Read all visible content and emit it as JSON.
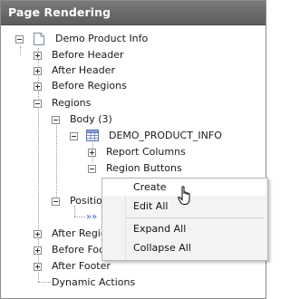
{
  "panel": {
    "title": "Page Rendering"
  },
  "tree": {
    "root": "Demo Product Info",
    "before_header": "Before Header",
    "after_header": "After Header",
    "before_regions": "Before Regions",
    "regions": "Regions",
    "body": "Body (3)",
    "region_name": "DEMO_PRODUCT_INFO",
    "report_columns": "Report Columns",
    "region_buttons": "Region Buttons",
    "position_partial": "Positio",
    "position_child_partial": "»»",
    "after_regions_partial": "After Regio",
    "before_footer_partial": "Before Foo",
    "after_footer": "After Footer",
    "dynamic_actions": "Dynamic Actions"
  },
  "context_menu": {
    "items": [
      "Create",
      "Edit All",
      "Expand All",
      "Collapse All"
    ],
    "hovered": "Create"
  }
}
